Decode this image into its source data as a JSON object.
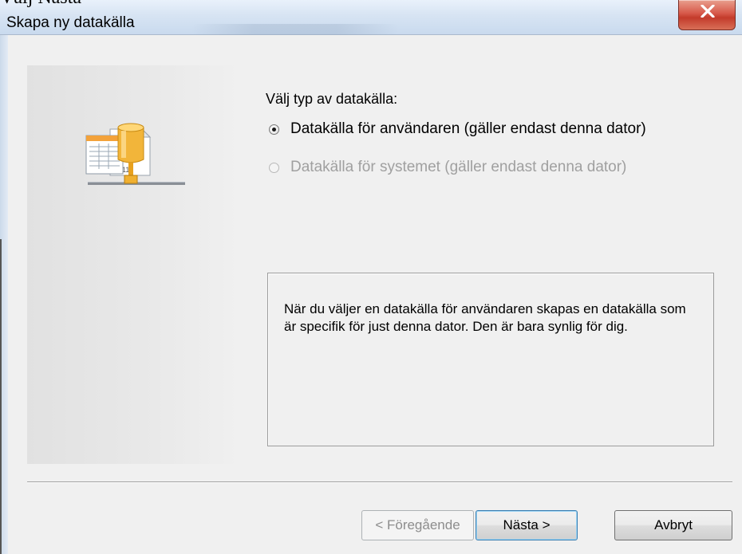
{
  "caption": "Välj Nästa",
  "window": {
    "title": "Skapa ny datakälla",
    "close_label": "X"
  },
  "content": {
    "prompt": "Välj typ av datakälla:",
    "options": [
      {
        "label": "Datakälla för användaren (gäller endast denna dator)",
        "checked": true,
        "enabled": true
      },
      {
        "label": "Datakälla för systemet (gäller endast denna dator)",
        "checked": false,
        "enabled": false
      }
    ],
    "description": "När du väljer en datakälla för användaren skapas en datakälla som är specifik för just denna dator. Den är bara synlig för dig.",
    "side_icon": "database-network-icon"
  },
  "buttons": {
    "previous": "< Föregående",
    "next": "Nästa >",
    "cancel": "Avbryt"
  },
  "colors": {
    "accent": "#3c7fb1",
    "close": "#c33b2b",
    "disabled_text": "#a0a0a0"
  }
}
